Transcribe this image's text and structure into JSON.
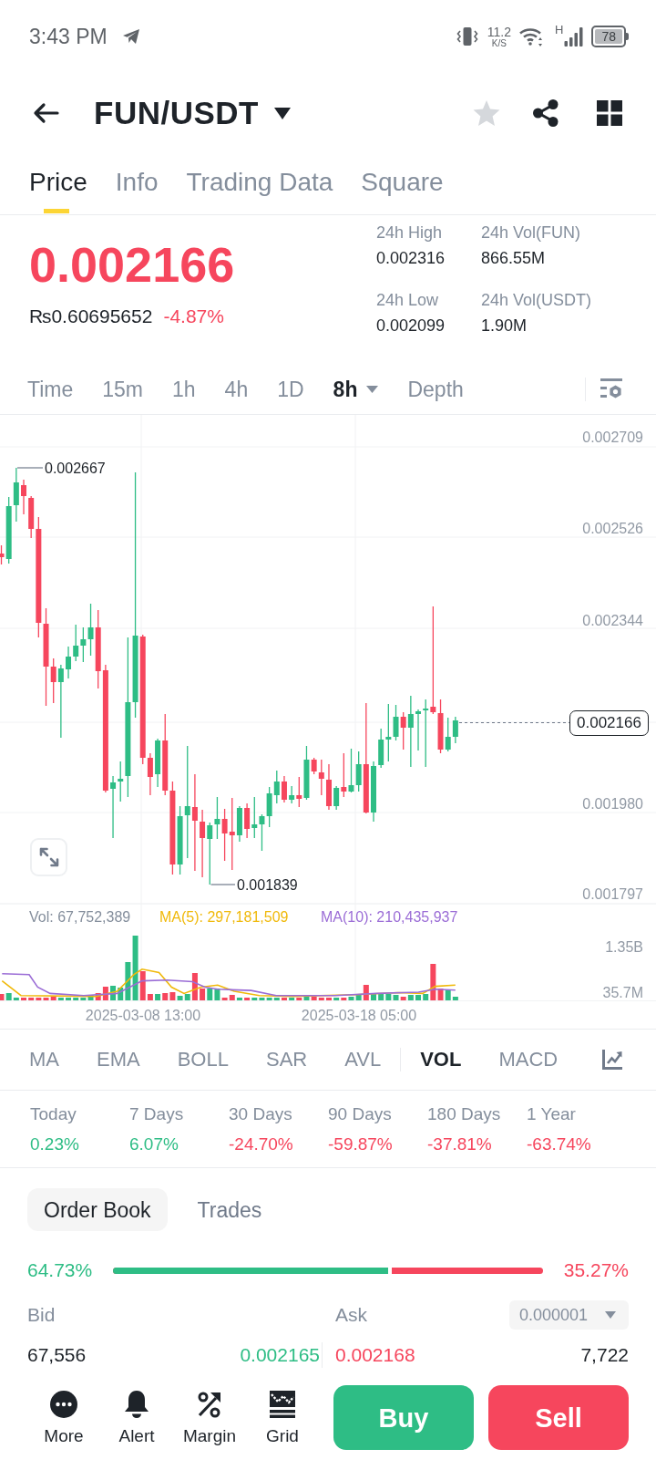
{
  "status_bar": {
    "time": "3:43 PM",
    "network_speed": "11.2",
    "speed_unit": "K/S",
    "network_type": "H",
    "battery": "78"
  },
  "header": {
    "pair": "FUN/USDT",
    "favorite": false
  },
  "tabs": [
    {
      "label": "Price",
      "selected": true
    },
    {
      "label": "Info",
      "selected": false
    },
    {
      "label": "Trading Data",
      "selected": false
    },
    {
      "label": "Square",
      "selected": false
    }
  ],
  "ticker": {
    "last_price": "0.002166",
    "fiat_price": "₨0.60695652",
    "change": "-4.87%",
    "positive": false,
    "stats": [
      {
        "label": "24h High",
        "value": "0.002316"
      },
      {
        "label": "24h Vol(FUN)",
        "value": "866.55M"
      },
      {
        "label": "24h Low",
        "value": "0.002099"
      },
      {
        "label": "24h Vol(USDT)",
        "value": "1.90M"
      }
    ]
  },
  "intervals": [
    {
      "label": "Time",
      "selected": false,
      "kind": "option"
    },
    {
      "label": "15m",
      "selected": false,
      "kind": "option"
    },
    {
      "label": "1h",
      "selected": false,
      "kind": "option"
    },
    {
      "label": "4h",
      "selected": false,
      "kind": "option"
    },
    {
      "label": "1D",
      "selected": false,
      "kind": "option"
    },
    {
      "label": "8h",
      "selected": true,
      "kind": "menu"
    },
    {
      "label": "Depth",
      "selected": false,
      "kind": "option"
    }
  ],
  "chart": {
    "price_axis": [
      "0.002709",
      "0.002526",
      "0.002344",
      "0.001980",
      "0.001797"
    ],
    "high_label": "0.002667",
    "low_label": "0.001839",
    "current_price": "0.002166",
    "legend": [
      {
        "label": "Vol: 67,752,389",
        "color": "#848e9c"
      },
      {
        "label": "MA(5): 297,181,509",
        "color": "#f0b90b"
      },
      {
        "label": "MA(10): 210,435,937",
        "color": "#9b6dd6"
      }
    ],
    "volume_axis": [
      "1.35B",
      "35.7M"
    ],
    "time_axis": [
      "2025-03-08 13:00",
      "2025-03-18 05:00"
    ]
  },
  "indicators": {
    "main": [
      {
        "label": "MA",
        "selected": false
      },
      {
        "label": "EMA",
        "selected": false
      },
      {
        "label": "BOLL",
        "selected": false
      },
      {
        "label": "SAR",
        "selected": false
      },
      {
        "label": "AVL",
        "selected": false
      }
    ],
    "sub": [
      {
        "label": "VOL",
        "selected": true
      },
      {
        "label": "MACD",
        "selected": false
      }
    ]
  },
  "performance": [
    {
      "label": "Today",
      "value": "0.23%",
      "positive": true
    },
    {
      "label": "7 Days",
      "value": "6.07%",
      "positive": true
    },
    {
      "label": "30 Days",
      "value": "-24.70%",
      "positive": false
    },
    {
      "label": "90 Days",
      "value": "-59.87%",
      "positive": false
    },
    {
      "label": "180 Days",
      "value": "-37.81%",
      "positive": false
    },
    {
      "label": "1 Year",
      "value": "-63.74%",
      "positive": false
    }
  ],
  "order_book": {
    "tabs": [
      {
        "label": "Order Book",
        "selected": true
      },
      {
        "label": "Trades",
        "selected": false
      }
    ],
    "bid_share": "64.73%",
    "ask_share": "35.27%",
    "level": 0.6473,
    "bid_label": "Bid",
    "ask_label": "Ask",
    "precision": "0.000001",
    "rows": [
      {
        "bid_amount": "67,556",
        "bid_price": "0.002165",
        "ask_price": "0.002168",
        "ask_amount": "7,722"
      }
    ]
  },
  "bottom_bar": {
    "actions": [
      {
        "label": "More",
        "kind": "more"
      },
      {
        "label": "Alert",
        "kind": "alert"
      },
      {
        "label": "Margin",
        "kind": "margin"
      },
      {
        "label": "Grid",
        "kind": "grid"
      }
    ],
    "buy": "Buy",
    "sell": "Sell"
  }
}
